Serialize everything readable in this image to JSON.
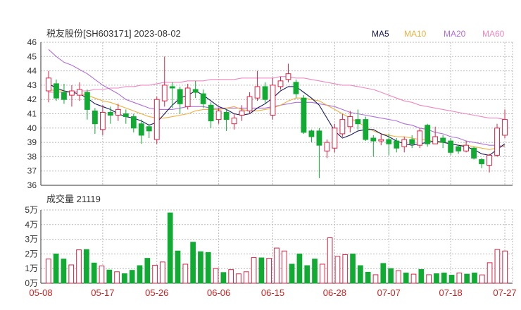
{
  "title": "税友股份[SH603171] 2023-08-02",
  "volume_title": "成交量 21119",
  "chart_data": [
    {
      "type": "candlestick",
      "title": "税友股份[SH603171] 2023-08-02",
      "ylim": [
        36,
        46
      ],
      "y_ticks": [
        "46",
        "45",
        "44",
        "43",
        "42",
        "41",
        "40",
        "39",
        "38",
        "37",
        "36"
      ],
      "x_ticks": [
        "05-08",
        "05-17",
        "05-26",
        "06-06",
        "06-15",
        "06-28",
        "07-07",
        "07-18",
        "07-27"
      ],
      "legend": [
        {
          "name": "MA5",
          "color": "#1a1a5e"
        },
        {
          "name": "MA10",
          "color": "#f0b040"
        },
        {
          "name": "MA20",
          "color": "#b070d8"
        },
        {
          "name": "MA60",
          "color": "#ee88c0"
        }
      ],
      "colors": {
        "up": "#dd2244",
        "down": "#11aa33"
      },
      "candles": [
        [
          42.6,
          43.5,
          44.0,
          41.8
        ],
        [
          43.1,
          42.1,
          43.4,
          41.9
        ],
        [
          42.5,
          42.0,
          43.1,
          41.7
        ],
        [
          42.3,
          42.6,
          43.0,
          41.5
        ],
        [
          42.3,
          42.7,
          43.2,
          41.9
        ],
        [
          42.5,
          41.3,
          42.7,
          40.6
        ],
        [
          41.2,
          40.3,
          41.4,
          39.6
        ],
        [
          39.9,
          41.1,
          41.6,
          39.5
        ],
        [
          41.1,
          40.9,
          41.5,
          40.3
        ],
        [
          40.9,
          41.3,
          41.7,
          40.5
        ],
        [
          41.0,
          40.8,
          41.3,
          40.3
        ],
        [
          40.8,
          40.0,
          41.0,
          39.7
        ],
        [
          40.3,
          39.5,
          40.6,
          38.9
        ],
        [
          40.1,
          39.8,
          40.3,
          39.3
        ],
        [
          39.2,
          42.0,
          42.2,
          38.9
        ],
        [
          41.9,
          43.0,
          45.0,
          41.5
        ],
        [
          42.9,
          42.8,
          43.2,
          41.4
        ],
        [
          42.7,
          41.7,
          42.9,
          41.0
        ],
        [
          41.5,
          42.8,
          43.1,
          41.3
        ],
        [
          42.7,
          42.5,
          43.3,
          42.1
        ],
        [
          42.4,
          41.7,
          42.7,
          41.4
        ],
        [
          41.6,
          40.5,
          41.8,
          40.0
        ],
        [
          40.6,
          41.2,
          41.4,
          40.3
        ],
        [
          41.1,
          40.6,
          41.3,
          39.8
        ],
        [
          40.3,
          40.7,
          41.0,
          39.9
        ],
        [
          40.9,
          41.2,
          41.6,
          40.5
        ],
        [
          41.2,
          42.2,
          42.5,
          41.0
        ],
        [
          42.1,
          42.9,
          44.0,
          41.9
        ],
        [
          42.9,
          42.0,
          43.2,
          41.7
        ],
        [
          40.9,
          43.0,
          43.5,
          40.6
        ],
        [
          42.9,
          43.3,
          43.6,
          42.7
        ],
        [
          43.4,
          43.8,
          44.5,
          43.2
        ],
        [
          43.2,
          42.4,
          43.4,
          42.1
        ],
        [
          42.1,
          39.7,
          42.3,
          39.6
        ],
        [
          39.8,
          39.4,
          39.9,
          39.0
        ],
        [
          39.8,
          38.8,
          40.0,
          36.5
        ],
        [
          38.4,
          39.0,
          39.2,
          37.9
        ],
        [
          38.6,
          40.0,
          40.3,
          38.3
        ],
        [
          39.6,
          40.6,
          41.0,
          39.4
        ],
        [
          40.1,
          40.8,
          41.2,
          39.7
        ],
        [
          40.6,
          40.3,
          41.3,
          39.9
        ],
        [
          40.6,
          39.2,
          40.8,
          39.1
        ],
        [
          39.3,
          39.1,
          39.5,
          38.0
        ],
        [
          39.1,
          39.2,
          39.6,
          38.8
        ],
        [
          39.2,
          38.9,
          39.6,
          38.1
        ],
        [
          39.1,
          38.6,
          39.3,
          38.3
        ],
        [
          38.7,
          39.2,
          39.4,
          38.3
        ],
        [
          39.2,
          38.9,
          39.5,
          38.6
        ],
        [
          38.8,
          39.8,
          40.0,
          38.6
        ],
        [
          40.2,
          38.9,
          40.3,
          38.7
        ],
        [
          38.9,
          39.4,
          40.1,
          38.9
        ],
        [
          39.3,
          39.0,
          39.5,
          38.6
        ],
        [
          39.1,
          38.3,
          39.3,
          38.1
        ],
        [
          38.7,
          38.4,
          38.8,
          38.2
        ],
        [
          38.4,
          38.8,
          39.1,
          38.3
        ],
        [
          38.6,
          37.9,
          38.7,
          37.8
        ],
        [
          37.8,
          37.5,
          37.9,
          37.2
        ],
        [
          37.4,
          38.1,
          38.2,
          36.9
        ],
        [
          38.1,
          40.0,
          40.3,
          38.0
        ],
        [
          39.5,
          40.6,
          41.3,
          39.3
        ]
      ],
      "ma5": [
        43.1,
        42.8,
        42.6,
        42.5,
        42.4,
        42.1,
        41.7,
        41.5,
        41.3,
        41.0,
        40.8,
        40.7,
        40.5,
        40.2,
        40.4,
        41.0,
        41.6,
        42.1,
        42.3,
        42.6,
        42.3,
        41.9,
        41.5,
        41.3,
        41.0,
        40.9,
        41.0,
        41.4,
        41.7,
        42.1,
        42.6,
        42.9,
        42.9,
        42.5,
        42.1,
        41.6,
        40.7,
        39.8,
        39.3,
        39.5,
        39.8,
        39.9,
        39.9,
        39.6,
        39.4,
        39.1,
        38.9,
        38.8,
        38.9,
        39.0,
        39.1,
        39.0,
        38.9,
        38.8,
        38.7,
        38.5,
        38.2,
        38.1,
        38.5,
        38.9
      ],
      "ma10": [
        42.7,
        42.6,
        42.6,
        42.5,
        42.4,
        42.3,
        42.1,
        41.9,
        41.8,
        41.6,
        41.4,
        41.2,
        41.0,
        40.8,
        40.7,
        40.7,
        40.8,
        40.9,
        41.0,
        41.2,
        41.3,
        41.3,
        41.3,
        41.4,
        41.5,
        41.3,
        41.2,
        41.2,
        41.3,
        41.4,
        41.6,
        41.9,
        42.1,
        42.1,
        42.0,
        41.9,
        41.6,
        41.3,
        41.0,
        40.7,
        40.4,
        40.1,
        39.8,
        39.6,
        39.5,
        39.4,
        39.4,
        39.3,
        39.2,
        39.2,
        39.0,
        39.0,
        38.9,
        38.8,
        38.8,
        38.7,
        38.6,
        38.5,
        38.6,
        38.8
      ],
      "ma20": [
        45.5,
        45.0,
        44.6,
        44.4,
        44.1,
        43.8,
        43.4,
        43.0,
        42.7,
        42.4,
        42.0,
        41.8,
        41.6,
        41.4,
        41.3,
        41.3,
        41.3,
        41.4,
        41.5,
        41.5,
        41.5,
        41.4,
        41.4,
        41.4,
        41.4,
        41.4,
        41.4,
        41.4,
        41.4,
        41.5,
        41.6,
        41.7,
        41.8,
        41.8,
        41.8,
        41.7,
        41.6,
        41.5,
        41.3,
        41.1,
        41.0,
        40.9,
        40.8,
        40.7,
        40.6,
        40.5,
        40.3,
        40.2,
        40.0,
        39.9,
        39.7,
        39.6,
        39.4,
        39.3,
        39.1,
        39.0,
        38.9,
        38.8,
        38.8,
        38.7
      ],
      "ma60": [
        42.5,
        42.5,
        42.5,
        42.5,
        42.6,
        42.6,
        42.7,
        42.7,
        42.8,
        42.8,
        42.9,
        42.9,
        43.0,
        43.0,
        43.1,
        43.2,
        43.2,
        43.2,
        43.3,
        43.3,
        43.3,
        43.4,
        43.4,
        43.4,
        43.4,
        43.5,
        43.5,
        43.5,
        43.5,
        43.5,
        43.6,
        43.6,
        43.5,
        43.5,
        43.4,
        43.3,
        43.2,
        43.1,
        43.0,
        43.0,
        42.9,
        42.8,
        42.7,
        42.5,
        42.3,
        42.1,
        41.9,
        41.8,
        41.6,
        41.5,
        41.4,
        41.3,
        41.2,
        41.1,
        41.0,
        40.9,
        40.8,
        40.7,
        40.7,
        40.6
      ]
    },
    {
      "type": "bar",
      "title": "成交量 21119",
      "ylim": [
        0,
        50000
      ],
      "y_ticks": [
        "5万",
        "4万",
        "3万",
        "2万",
        "1万",
        "0万"
      ],
      "values": [
        16500,
        20000,
        16500,
        12500,
        22800,
        23000,
        13800,
        11800,
        9000,
        7800,
        6500,
        8800,
        12000,
        17000,
        12300,
        14500,
        48000,
        22000,
        13000,
        28000,
        21500,
        21000,
        10000,
        7300,
        9300,
        6400,
        7800,
        17500,
        17300,
        17000,
        24000,
        22000,
        13000,
        20000,
        12000,
        16500,
        13000,
        31000,
        18300,
        19500,
        20000,
        12000,
        7500,
        5800,
        13500,
        10000,
        8600,
        7000,
        6200,
        9400,
        5800,
        6500,
        7000,
        5500,
        7000,
        6200,
        7000,
        5700,
        14000,
        23000,
        22000
      ]
    }
  ]
}
